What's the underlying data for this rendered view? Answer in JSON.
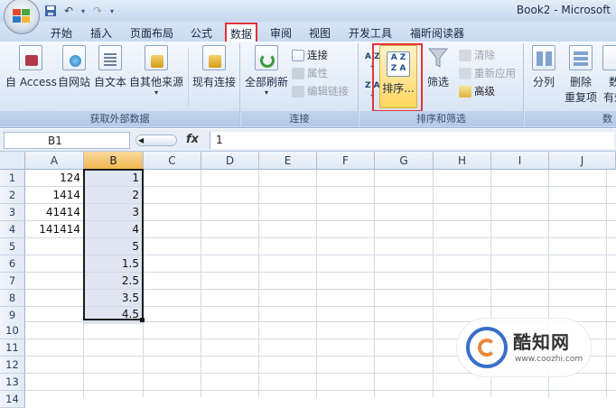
{
  "window": {
    "title": "Book2 - Microsoft"
  },
  "tabs": [
    "开始",
    "插入",
    "页面布局",
    "公式",
    "数据",
    "审阅",
    "视图",
    "开发工具",
    "福昕阅读器"
  ],
  "active_tab": "数据",
  "ribbon": {
    "external": {
      "label": "获取外部数据",
      "access": "自 Access",
      "web": "自网站",
      "text": "自文本",
      "other": "自其他来源",
      "existing": "现有连接"
    },
    "connections": {
      "label": "连接",
      "refresh": "全部刷新",
      "connections": "连接",
      "properties": "属性",
      "edit_links": "编辑链接"
    },
    "sort": {
      "label": "排序和筛选",
      "sort": "排序...",
      "filter": "筛选",
      "clear": "清除",
      "reapply": "重新应用",
      "advanced": "高级",
      "az": "A Z",
      "za": "Z A"
    },
    "tools": {
      "split": "分列",
      "remove_dup_1": "删除",
      "remove_dup_2": "重复项",
      "valid_1": "数",
      "valid_2": "有效"
    }
  },
  "formula_bar": {
    "name_box": "B1",
    "fx": "fx",
    "value": "1"
  },
  "columns": [
    "A",
    "B",
    "C",
    "D",
    "E",
    "F",
    "G",
    "H",
    "I",
    "J"
  ],
  "rows": [
    "1",
    "2",
    "3",
    "4",
    "5",
    "6",
    "7",
    "8",
    "9",
    "10",
    "11",
    "12",
    "13",
    "14"
  ],
  "cells": {
    "A": [
      "124",
      "1414",
      "41414",
      "141414"
    ],
    "B": [
      "1",
      "2",
      "3",
      "4",
      "5",
      "1.5",
      "2.5",
      "3.5",
      "4.5"
    ]
  },
  "watermark": {
    "title": "酷知网",
    "url": "www.coozhi.com"
  },
  "colors": {
    "highlight": "#e2333a",
    "accent": "#3a6fc9"
  }
}
